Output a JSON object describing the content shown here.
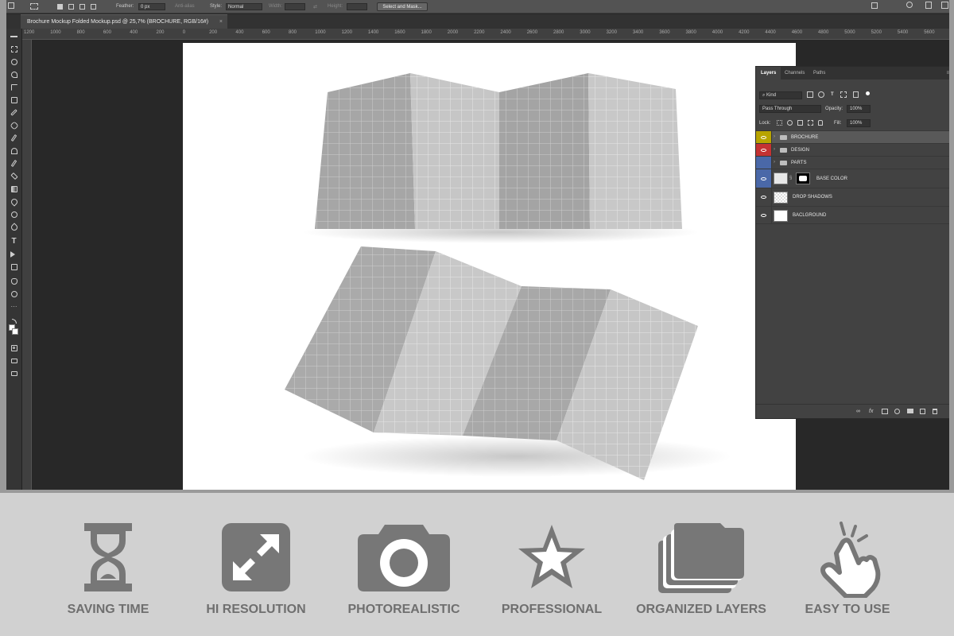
{
  "options_bar": {
    "feather_label": "Feather:",
    "feather_value": "0 px",
    "antialias_label": "Anti-alias",
    "style_label": "Style:",
    "style_value": "Normal",
    "width_label": "Width:",
    "height_label": "Height:",
    "select_mask_label": "Select and Mask..."
  },
  "document_tab": {
    "title": "Brochure Mockup Folded Mockup.psd @ 25,7% (BROCHURE, RGB/16#)",
    "close": "×"
  },
  "ruler_labels": [
    "1200",
    "1000",
    "800",
    "600",
    "400",
    "200",
    "0",
    "200",
    "400",
    "600",
    "800",
    "1000",
    "1200",
    "1400",
    "1600",
    "1800",
    "2000",
    "2200",
    "2400",
    "2600",
    "2800",
    "3000",
    "3200",
    "3400",
    "3600",
    "3800",
    "4000",
    "4200",
    "4400",
    "4600",
    "4800",
    "5000",
    "5200",
    "5400",
    "5600",
    "5800"
  ],
  "layers_panel": {
    "tabs": [
      "Layers",
      "Channels",
      "Paths"
    ],
    "filter_label": "Kind",
    "blend_mode": "Pass Through",
    "opacity_label": "Opacity:",
    "opacity_value": "100%",
    "lock_label": "Lock:",
    "fill_label": "Fill:",
    "fill_value": "100%",
    "layers": [
      {
        "name": "BROCHURE",
        "type": "group",
        "eye_color": "#b8a400",
        "visible": true,
        "selected": true
      },
      {
        "name": "DESIGN",
        "type": "group",
        "eye_color": "#c43232",
        "visible": true
      },
      {
        "name": "PARTS",
        "type": "group",
        "eye_color": "#4a68a8",
        "visible": false
      },
      {
        "name": "BASE COLOR",
        "type": "layer_with_mask",
        "eye_color": "#4a68a8",
        "visible": true
      },
      {
        "name": "DROP SHADOWS",
        "type": "layer",
        "eye_color": "",
        "visible": true
      },
      {
        "name": "BACLGROUND",
        "type": "layer",
        "eye_color": "",
        "visible": true
      }
    ]
  },
  "features": [
    {
      "label": "SAVING TIME",
      "icon": "hourglass-icon"
    },
    {
      "label": "HI RESOLUTION",
      "icon": "expand-arrows-icon"
    },
    {
      "label": "PHOTOREALISTIC",
      "icon": "camera-icon"
    },
    {
      "label": "PROFESSIONAL",
      "icon": "star-icon"
    },
    {
      "label": "ORGANIZED LAYERS",
      "icon": "layered-folders-icon"
    },
    {
      "label": "EASY TO USE",
      "icon": "tap-hand-icon"
    }
  ],
  "colors": {
    "feature_icon": "#777777",
    "feature_text": "#6f6f6f",
    "strip_bg": "#d1d1d1",
    "app_bg": "#282828"
  }
}
